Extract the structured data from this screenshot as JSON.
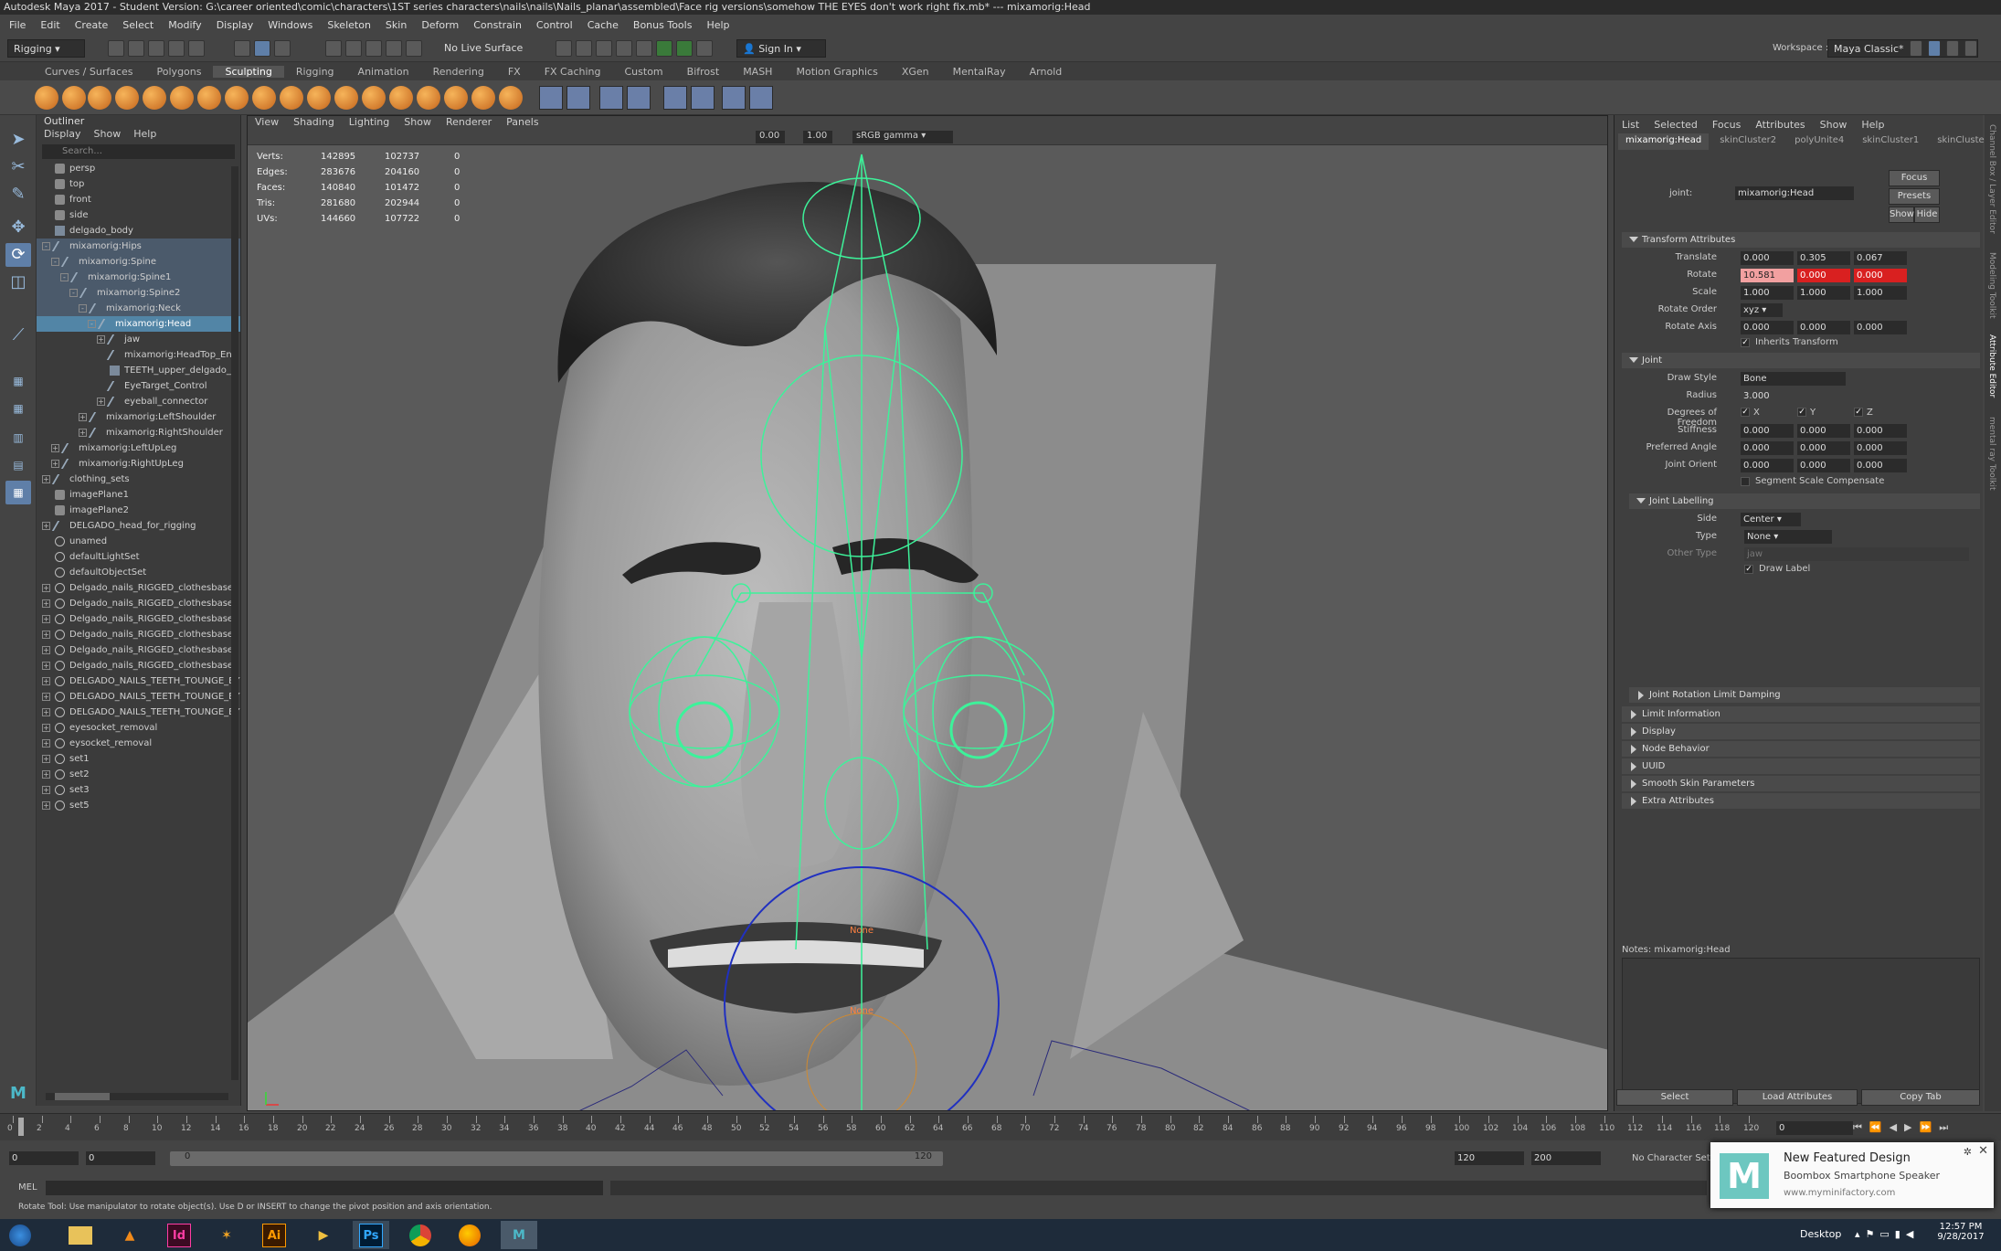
{
  "title": "Autodesk Maya 2017 - Student Version: G:\\career oriented\\comic\\characters\\1ST series characters\\nails\\nails\\Nails_planar\\assembled\\Face rig versions\\somehow THE EYES don't work right fix.mb*   ---   mixamorig:Head",
  "menus": [
    "File",
    "Edit",
    "Create",
    "Select",
    "Modify",
    "Display",
    "Windows",
    "Skeleton",
    "Skin",
    "Deform",
    "Constrain",
    "Control",
    "Cache",
    "Bonus Tools",
    "Help"
  ],
  "workspace_label": "Workspace :",
  "workspace_value": "Maya Classic*",
  "menuset": "Rigging",
  "live_surface": "No Live Surface",
  "sign_in": "Sign In",
  "shelf_tabs": [
    "Curves / Surfaces",
    "Polygons",
    "Sculpting",
    "Rigging",
    "Animation",
    "Rendering",
    "FX",
    "FX Caching",
    "Custom",
    "Bifrost",
    "MASH",
    "Motion Graphics",
    "XGen",
    "MentalRay",
    "Arnold"
  ],
  "shelf_active": "Sculpting",
  "outliner": {
    "title": "Outliner",
    "menu": [
      "Display",
      "Show",
      "Help"
    ],
    "search_placeholder": "Search...",
    "rows": [
      {
        "label": "persp",
        "indent": 0,
        "type": "cam",
        "exp": ""
      },
      {
        "label": "top",
        "indent": 0,
        "type": "cam",
        "exp": ""
      },
      {
        "label": "front",
        "indent": 0,
        "type": "cam",
        "exp": ""
      },
      {
        "label": "side",
        "indent": 0,
        "type": "cam",
        "exp": ""
      },
      {
        "label": "delgado_body",
        "indent": 0,
        "type": "mesh",
        "exp": ""
      },
      {
        "label": "mixamorig:Hips",
        "indent": 0,
        "type": "joint",
        "exp": "-",
        "hl": true
      },
      {
        "label": "mixamorig:Spine",
        "indent": 1,
        "type": "joint",
        "exp": "-",
        "hl": true
      },
      {
        "label": "mixamorig:Spine1",
        "indent": 2,
        "type": "joint",
        "exp": "-",
        "hl": true
      },
      {
        "label": "mixamorig:Spine2",
        "indent": 3,
        "type": "joint",
        "exp": "-",
        "hl": true
      },
      {
        "label": "mixamorig:Neck",
        "indent": 4,
        "type": "joint",
        "exp": "-",
        "hl": true
      },
      {
        "label": "mixamorig:Head",
        "indent": 5,
        "type": "joint",
        "exp": "-",
        "sel": true
      },
      {
        "label": "jaw",
        "indent": 6,
        "type": "joint",
        "exp": "+"
      },
      {
        "label": "mixamorig:HeadTop_En",
        "indent": 6,
        "type": "joint",
        "exp": ""
      },
      {
        "label": "TEETH_upper_delgado_",
        "indent": 6,
        "type": "mesh",
        "exp": ""
      },
      {
        "label": "EyeTarget_Control",
        "indent": 6,
        "type": "joint",
        "exp": ""
      },
      {
        "label": "eyeball_connector",
        "indent": 6,
        "type": "joint",
        "exp": "+"
      },
      {
        "label": "mixamorig:LeftShoulder",
        "indent": 4,
        "type": "joint",
        "exp": "+"
      },
      {
        "label": "mixamorig:RightShoulder",
        "indent": 4,
        "type": "joint",
        "exp": "+"
      },
      {
        "label": "mixamorig:LeftUpLeg",
        "indent": 1,
        "type": "joint",
        "exp": "+"
      },
      {
        "label": "mixamorig:RightUpLeg",
        "indent": 1,
        "type": "joint",
        "exp": "+"
      },
      {
        "label": "clothing_sets",
        "indent": 0,
        "type": "joint",
        "exp": "+"
      },
      {
        "label": "imagePlane1",
        "indent": 0,
        "type": "cam",
        "exp": ""
      },
      {
        "label": "imagePlane2",
        "indent": 0,
        "type": "cam",
        "exp": ""
      },
      {
        "label": "DELGADO_head_for_rigging",
        "indent": 0,
        "type": "joint",
        "exp": "+"
      },
      {
        "label": "unamed",
        "indent": 0,
        "type": "set",
        "exp": ""
      },
      {
        "label": "defaultLightSet",
        "indent": 0,
        "type": "set",
        "exp": ""
      },
      {
        "label": "defaultObjectSet",
        "indent": 0,
        "type": "set",
        "exp": ""
      },
      {
        "label": "Delgado_nails_RIGGED_clothesbase_",
        "indent": 0,
        "type": "set",
        "exp": "+"
      },
      {
        "label": "Delgado_nails_RIGGED_clothesbase_",
        "indent": 0,
        "type": "set",
        "exp": "+"
      },
      {
        "label": "Delgado_nails_RIGGED_clothesbase_",
        "indent": 0,
        "type": "set",
        "exp": "+"
      },
      {
        "label": "Delgado_nails_RIGGED_clothesbase_",
        "indent": 0,
        "type": "set",
        "exp": "+"
      },
      {
        "label": "Delgado_nails_RIGGED_clothesbase_",
        "indent": 0,
        "type": "set",
        "exp": "+"
      },
      {
        "label": "Delgado_nails_RIGGED_clothesbase_",
        "indent": 0,
        "type": "set",
        "exp": "+"
      },
      {
        "label": "DELGADO_NAILS_TEETH_TOUNGE_EYE",
        "indent": 0,
        "type": "set",
        "exp": "+"
      },
      {
        "label": "DELGADO_NAILS_TEETH_TOUNGE_EYE",
        "indent": 0,
        "type": "set",
        "exp": "+"
      },
      {
        "label": "DELGADO_NAILS_TEETH_TOUNGE_EYE",
        "indent": 0,
        "type": "set",
        "exp": "+"
      },
      {
        "label": "eyesocket_removal",
        "indent": 0,
        "type": "set",
        "exp": "+"
      },
      {
        "label": "eysocket_removal",
        "indent": 0,
        "type": "set",
        "exp": "+"
      },
      {
        "label": "set1",
        "indent": 0,
        "type": "set",
        "exp": "+"
      },
      {
        "label": "set2",
        "indent": 0,
        "type": "set",
        "exp": "+"
      },
      {
        "label": "set3",
        "indent": 0,
        "type": "set",
        "exp": "+"
      },
      {
        "label": "set5",
        "indent": 0,
        "type": "set",
        "exp": "+"
      }
    ]
  },
  "viewport": {
    "menu": [
      "View",
      "Shading",
      "Lighting",
      "Show",
      "Renderer",
      "Panels"
    ],
    "exposure": "0.00",
    "gamma": "1.00",
    "colorspace": "sRGB gamma",
    "hud": [
      {
        "label": "Verts:",
        "a": "142895",
        "b": "102737",
        "c": "0"
      },
      {
        "label": "Edges:",
        "a": "283676",
        "b": "204160",
        "c": "0"
      },
      {
        "label": "Faces:",
        "a": "140840",
        "b": "101472",
        "c": "0"
      },
      {
        "label": "Tris:",
        "a": "281680",
        "b": "202944",
        "c": "0"
      },
      {
        "label": "UVs:",
        "a": "144660",
        "b": "107722",
        "c": "0"
      }
    ],
    "joint_labels": [
      "None",
      "None"
    ]
  },
  "ae": {
    "menu": [
      "List",
      "Selected",
      "Focus",
      "Attributes",
      "Show",
      "Help"
    ],
    "tabs": [
      "mixamorig:Head",
      "skinCluster2",
      "polyUnite4",
      "skinCluster1",
      "skinCluster3"
    ],
    "joint_label": "joint:",
    "joint_value": "mixamorig:Head",
    "focus": "Focus",
    "presets": "Presets",
    "show": "Show",
    "hide": "Hide",
    "transform_title": "Transform Attributes",
    "translate_label": "Translate",
    "translate": [
      "0.000",
      "0.305",
      "0.067"
    ],
    "rotate_label": "Rotate",
    "rotate": [
      "10.581",
      "0.000",
      "0.000"
    ],
    "scale_label": "Scale",
    "scale": [
      "1.000",
      "1.000",
      "1.000"
    ],
    "rotate_order_label": "Rotate Order",
    "rotate_order": "xyz",
    "rotate_axis_label": "Rotate Axis",
    "rotate_axis": [
      "0.000",
      "0.000",
      "0.000"
    ],
    "inherits": "Inherits Transform",
    "joint_title": "Joint",
    "draw_style_label": "Draw Style",
    "draw_style": "Bone",
    "radius_label": "Radius",
    "radius": "3.000",
    "dof_label": "Degrees of Freedom",
    "dof": [
      "X",
      "Y",
      "Z"
    ],
    "stiffness_label": "Stiffness",
    "stiffness": [
      "0.000",
      "0.000",
      "0.000"
    ],
    "pref_angle_label": "Preferred Angle",
    "pref_angle": [
      "0.000",
      "0.000",
      "0.000"
    ],
    "joint_orient_label": "Joint Orient",
    "joint_orient": [
      "0.000",
      "0.000",
      "0.000"
    ],
    "seg_scale": "Segment Scale Compensate",
    "labelling_title": "Joint Labelling",
    "side_label": "Side",
    "side": "Center",
    "type_label": "Type",
    "type": "None",
    "other_type_label": "Other Type",
    "other_type": "jaw",
    "draw_label": "Draw Label",
    "closed_sections": [
      "Joint Rotation Limit Damping",
      "Limit Information",
      "Display",
      "Node Behavior",
      "UUID",
      "Smooth Skin Parameters",
      "Extra Attributes"
    ],
    "notes_label": "Notes:  mixamorig:Head",
    "buttons": [
      "Select",
      "Load Attributes",
      "Copy Tab"
    ]
  },
  "right_vertical_tabs": [
    "Channel Box / Layer Editor",
    "Modeling Toolkit",
    "Attribute Editor",
    "mental ray Toolkit"
  ],
  "timeline": {
    "ticks": [
      "0",
      "2",
      "4",
      "6",
      "8",
      "10",
      "12",
      "14",
      "16",
      "18",
      "20",
      "22",
      "24",
      "26",
      "28",
      "30",
      "32",
      "34",
      "36",
      "38",
      "40",
      "42",
      "44",
      "46",
      "48",
      "50",
      "52",
      "54",
      "56",
      "58",
      "60",
      "62",
      "64",
      "66",
      "68",
      "70",
      "72",
      "74",
      "76",
      "78",
      "80",
      "82",
      "84",
      "86",
      "88",
      "90",
      "92",
      "94",
      "96",
      "98",
      "100",
      "102",
      "104",
      "106",
      "108",
      "110",
      "112",
      "114",
      "116",
      "118",
      "120"
    ],
    "current_frame": "0",
    "range_start": "0",
    "range_start2": "0",
    "range_slider_start": "0",
    "range_slider_end": "120",
    "anim_end": "120",
    "anim_end2": "200",
    "character_set": "No Character Set"
  },
  "cmd_label": "MEL",
  "help_text": "Rotate Tool: Use manipulator to rotate object(s). Use D or INSERT to change the pivot position and axis orientation.",
  "toast": {
    "title": "New Featured Design",
    "subtitle": "Boombox Smartphone Speaker",
    "url": "www.myminifactory.com"
  },
  "taskbar": {
    "apps": [
      "Id",
      "Ai",
      "Ps"
    ],
    "desktop": "Desktop",
    "time": "12:57 PM",
    "date": "9/28/2017"
  },
  "colors": {
    "accent_select": "#5285a6",
    "rig_green": "#3df29a",
    "rotate_highlight": "#d92020"
  }
}
